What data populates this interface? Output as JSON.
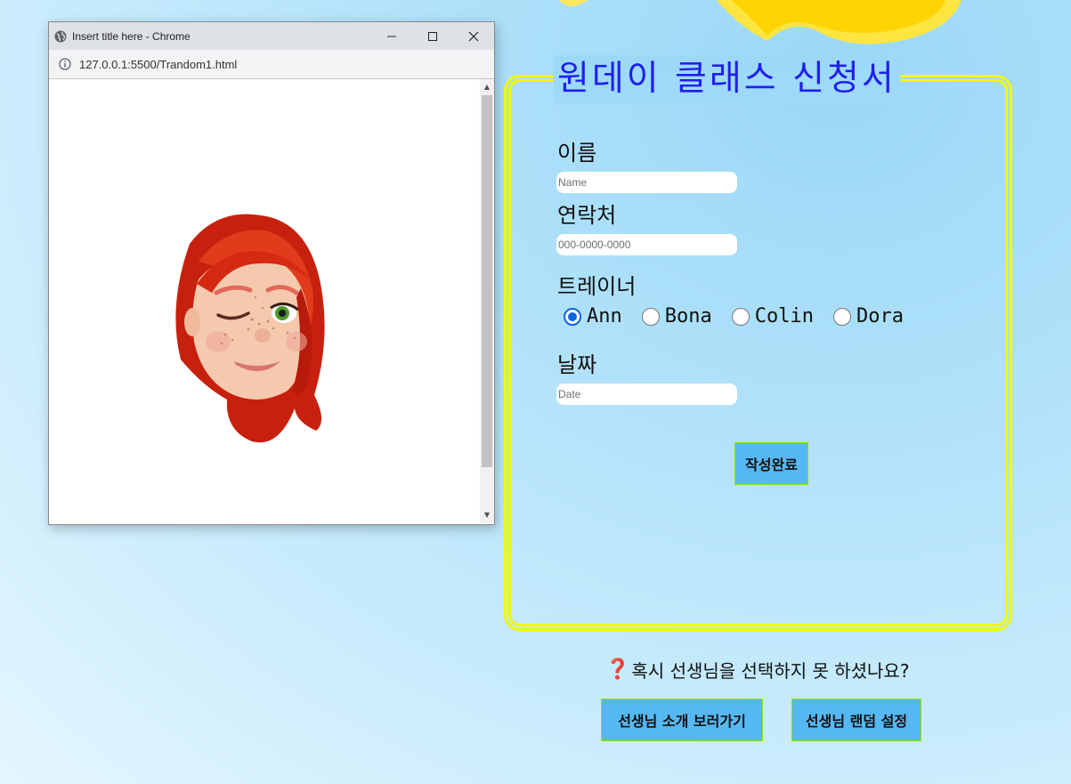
{
  "popup": {
    "title": "Insert title here - Chrome",
    "url": "127.0.0.1:5500/Trandom1.html",
    "minimize": "–",
    "maximize": "☐",
    "close": "✕"
  },
  "form": {
    "title": "원데이 클래스 신청서",
    "name_label": "이름",
    "name_placeholder": "Name",
    "phone_label": "연락처",
    "phone_placeholder": "000-0000-0000",
    "trainer_label": "트레이너",
    "trainers": [
      "Ann",
      "Bona",
      "Colin",
      "Dora"
    ],
    "selected_trainer": "Ann",
    "date_label": "날짜",
    "date_placeholder": "Date",
    "submit_label": "작성완료"
  },
  "footer": {
    "question_icon": "❓",
    "question_text": "혹시 선생님을 선택하지 못 하셨나요?",
    "intro_button": "선생님 소개 보러가기",
    "random_button": "선생님 랜덤 설정"
  },
  "colors": {
    "title_blue": "#1f1ff0",
    "border_yellow": "#f2f800",
    "button_blue": "#56b8f2",
    "radio_blue": "#0b64de"
  }
}
